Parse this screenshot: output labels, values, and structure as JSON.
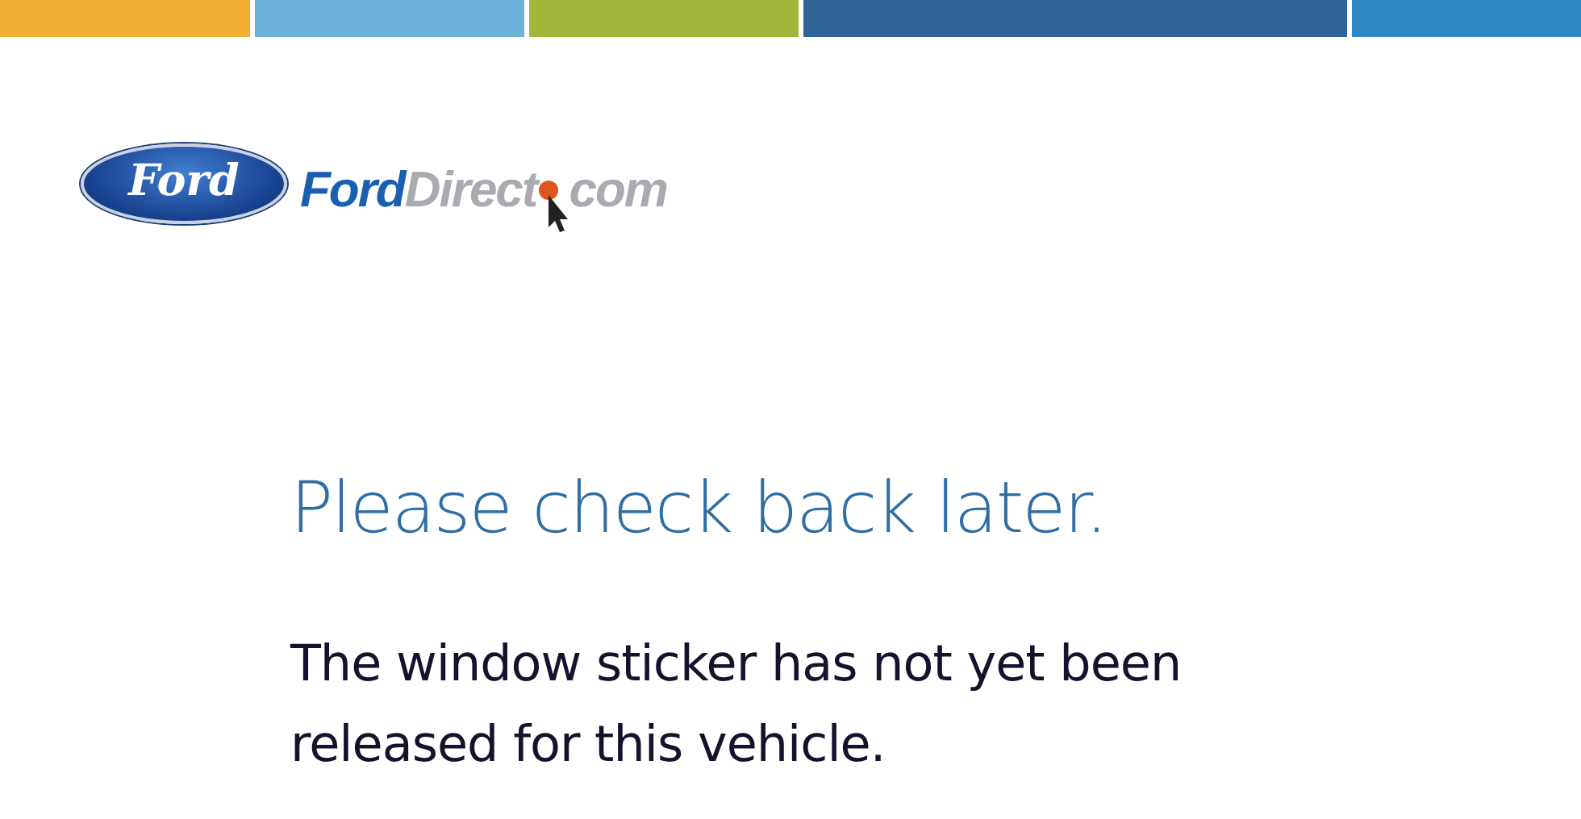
{
  "stripes": [
    {
      "color": "#f0ae36"
    },
    {
      "color": "#6cb2d8"
    },
    {
      "color": "#a2b73a"
    },
    {
      "color": "#2e6496"
    },
    {
      "color": "#2f86c4"
    }
  ],
  "logo": {
    "emblem": "Ford",
    "wordmark": [
      "Ford",
      "Direct",
      "com"
    ]
  },
  "heading": "Please check back later.",
  "message": "The window sticker has not yet been released for this vehicle."
}
